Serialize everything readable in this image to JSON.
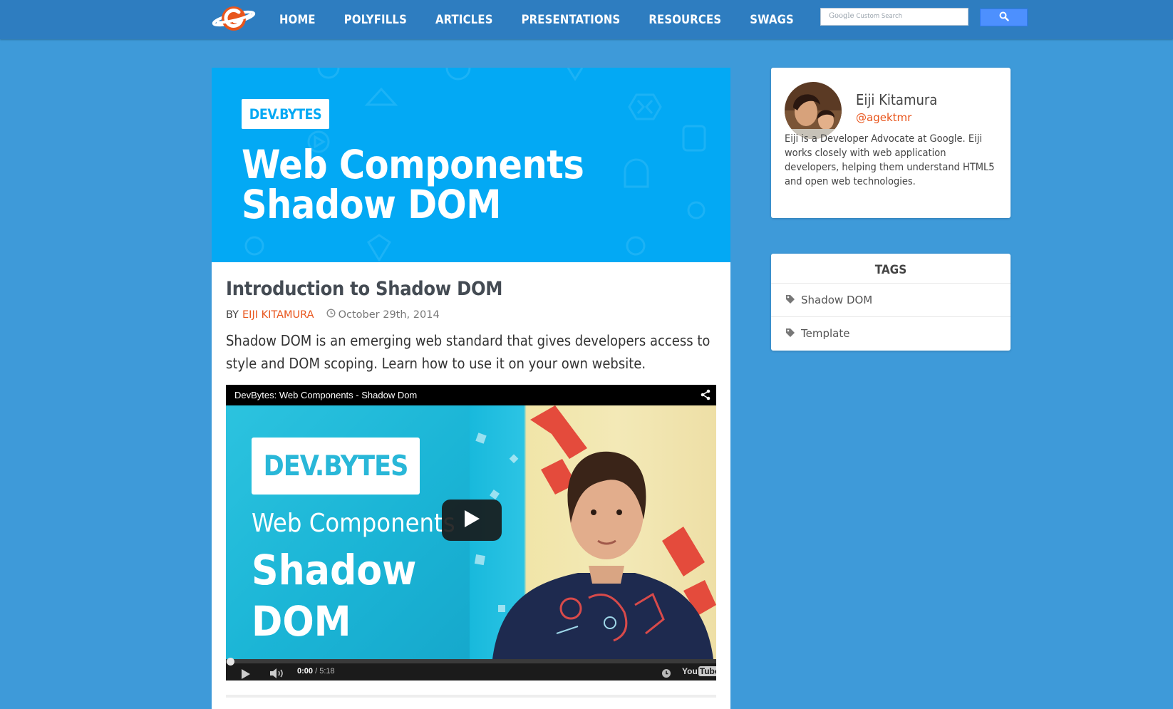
{
  "nav": {
    "items": [
      {
        "label": "HOME"
      },
      {
        "label": "POLYFILLS"
      },
      {
        "label": "ARTICLES"
      },
      {
        "label": "PRESENTATIONS"
      },
      {
        "label": "RESOURCES"
      },
      {
        "label": "SWAGS"
      }
    ],
    "search": {
      "brand": "Google",
      "brand_suffix": "Custom Search",
      "button_icon": "search-icon"
    }
  },
  "hero": {
    "badge": "DEV.BYTES",
    "title_line1": "Web Components",
    "title_line2": "Shadow DOM"
  },
  "post": {
    "title": "Introduction to Shadow DOM",
    "by": "BY",
    "author": "EIJI KITAMURA",
    "date": "October 29th, 2014",
    "summary": "Shadow DOM is an emerging web standard that gives developers access to style and DOM scoping. Learn how to use it on your own website."
  },
  "video": {
    "title": "DevBytes: Web Components - Shadow Dom",
    "thumb_badge": "DEV.BYTES",
    "thumb_sub": "Web Components",
    "thumb_main_line1": "Shadow",
    "thumb_main_line2": "DOM",
    "time_current": "0:00",
    "time_sep": " / ",
    "time_total": "5:18",
    "progress": 0,
    "logo_you": "You",
    "logo_tube": "Tube"
  },
  "author_card": {
    "name": "Eiji Kitamura",
    "handle": "@agektmr",
    "bio": "Eiji is a Developer Advocate at Google. Eiji works closely with web application developers, helping them understand HTML5 and open web technologies."
  },
  "tags": {
    "title": "TAGS",
    "items": [
      {
        "label": "Shadow DOM"
      },
      {
        "label": "Template"
      }
    ]
  },
  "colors": {
    "page_bg": "#3e9ad9",
    "nav_bg": "#2e7dc0",
    "hero_bg": "#03a9f4",
    "accent_orange": "#e8551c",
    "search_button": "#4d90fe"
  }
}
